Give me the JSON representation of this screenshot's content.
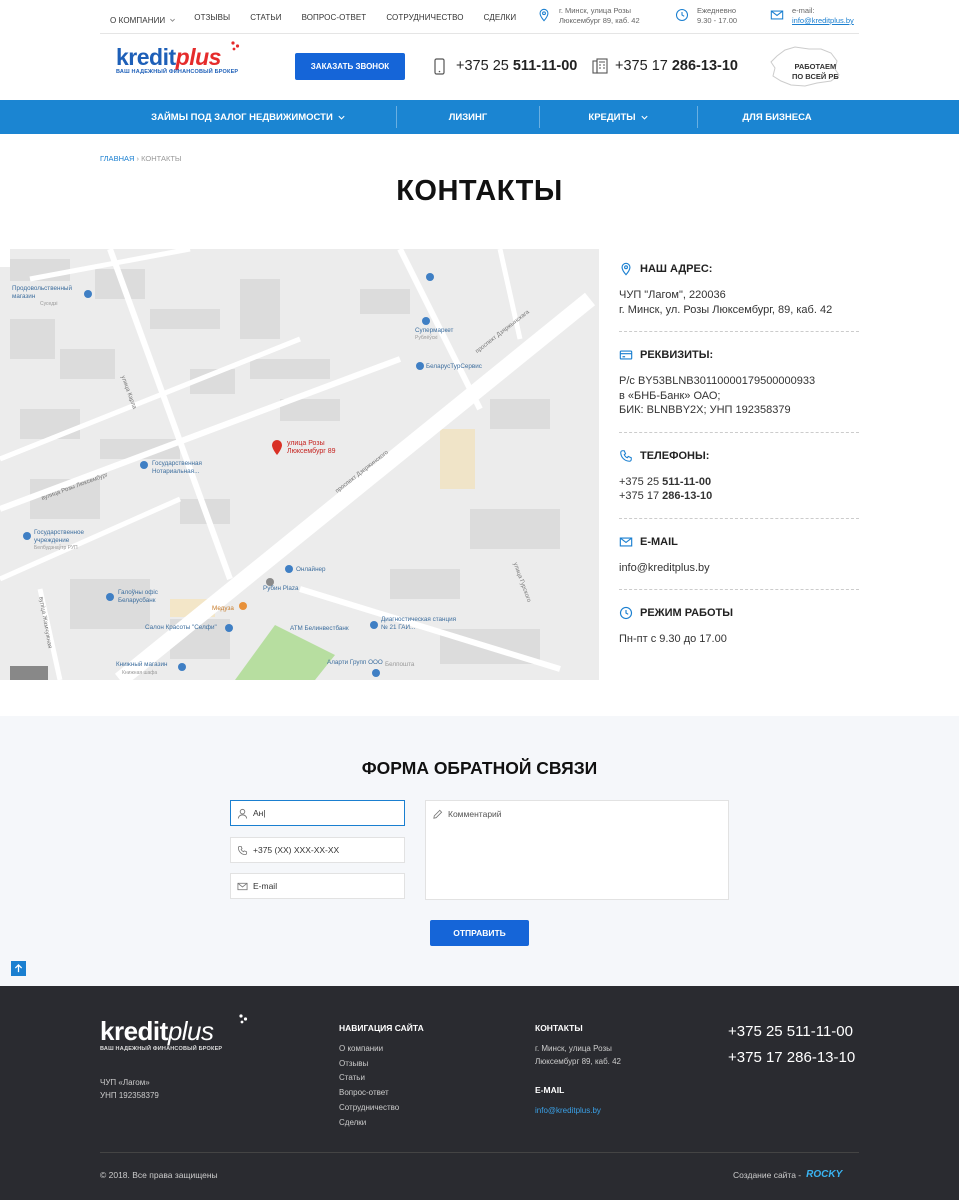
{
  "topnav": {
    "items": [
      "О компании",
      "Отзывы",
      "Статьи",
      "Вопрос-ответ",
      "Сотрудничество",
      "Сделки"
    ],
    "address_line1": "г. Минск, улица Розы",
    "address_line2": "Люксембург 89, каб. 42",
    "hours_line1": "Ежедневно",
    "hours_line2": "9.30 - 17.00",
    "email_label": "e-mail:",
    "email": "info@kreditplus.by"
  },
  "header": {
    "logo_main": "kredit",
    "logo_accent": "plus",
    "logo_sub": "ваш надежный финансовый брокер",
    "call_button": "Заказать звонок",
    "phone1_prefix": "+375 25",
    "phone1_number": "511-11-00",
    "phone2_prefix": "+375 17",
    "phone2_number": "286-13-10",
    "belarus_line1": "Работаем",
    "belarus_line2": "по всей РБ"
  },
  "mainnav": [
    "Займы под залог недвижимости",
    "Лизинг",
    "Кредиты",
    "Для бизнеса"
  ],
  "breadcrumb": {
    "home": "Главная",
    "sep": "›",
    "current": "Контакты"
  },
  "page_title": "Контакты",
  "map": {
    "pin_label_1": "улица Розы",
    "pin_label_2": "Люксембург 89",
    "poi": [
      "Продовольственный магазин",
      "Суседзі",
      "Супермаркет",
      "Рублёўскі",
      "БеларусТурСервис",
      "Государственная Нотариальная...",
      "Государственное учреждение",
      "Белбудзнаўтр РУП",
      "Галоўны офіс Беларусбанк",
      "Рубин Plaza",
      "Онлайнер",
      "Медуза",
      "Салон Красоты \"Селфи\"",
      "АТМ Белинвестбанк",
      "Диагностическая станция № 21 ГАИ...",
      "Книжный магазин",
      "Книжная шафа",
      "Аларти Групп ООО",
      "Белпошта"
    ],
    "streets": [
      "проспект Дзержинского",
      "проспект Дзяржынскага",
      "вулица Розы Люксембург",
      "улица Карла",
      "улица Гурского",
      "вуліца Жамчужная"
    ]
  },
  "contacts": {
    "address_title": "Наш адрес:",
    "address_line1": "ЧУП \"Лагом\", 220036",
    "address_line2": "г. Минск, ул. Розы Люксембург, 89, каб. 42",
    "requisites_title": "Реквизиты:",
    "req_line1": "Р/с BY53BLNB30110000179500000933",
    "req_line2": "в «БНБ-Банк» ОАО;",
    "req_line3": "БИК: BLNBBY2X; УНП 192358379",
    "phones_title": "Телефоны:",
    "phone1_prefix": "+375 25",
    "phone1_number": "511-11-00",
    "phone2_prefix": "+375 17",
    "phone2_number": "286-13-10",
    "email_title": "E-mail",
    "email": "info@kreditplus.by",
    "hours_title": "Режим работы",
    "hours": "Пн-пт с 9.30 до 17.00"
  },
  "form": {
    "title": "Форма обратной связи",
    "name_value": "Ан|",
    "phone_placeholder": "+375 (XX) XXX-XX-XX",
    "email_placeholder": "E-mail",
    "comment_placeholder": "Комментарий",
    "submit": "Отправить"
  },
  "footer": {
    "logo_main": "kredit",
    "logo_accent": "plus",
    "logo_sub": "ваш надежный финансовый брокер",
    "company_line1": "ЧУП «Лагом»",
    "company_line2": "УНП 192358379",
    "nav_title": "Навигация сайта",
    "nav_items": [
      "О компании",
      "Отзывы",
      "Статьи",
      "Вопрос-ответ",
      "Сотрудничество",
      "Сделки"
    ],
    "contacts_title": "Контакты",
    "address_line1": "г. Минск, улица Розы",
    "address_line2": "Люксембург 89, каб. 42",
    "email_title": "E-mail",
    "email": "info@kreditplus.by",
    "phone1": "+375 25 511-11-00",
    "phone2": "+375 17 286-13-10",
    "copyright": "© 2018. Все права защищены",
    "made_by_label": "Создание сайта -",
    "made_by_brand": "ROCKY"
  },
  "colors": {
    "primary": "#1565d8",
    "nav": "#1b85d2",
    "accent_red": "#e52b2b",
    "footer_bg": "#2a2b30"
  }
}
